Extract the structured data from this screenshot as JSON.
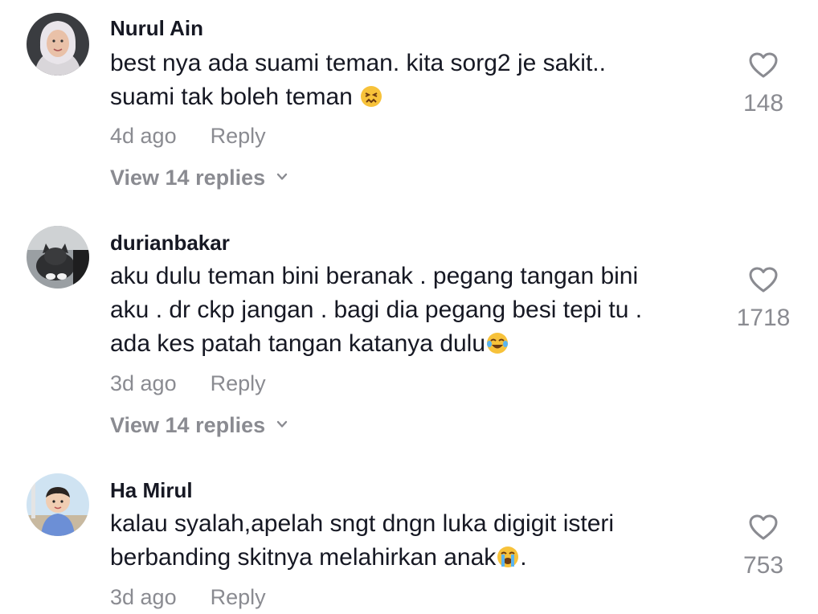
{
  "comments": [
    {
      "username": "Nurul Ain",
      "lines": [
        "best nya ada suami teman. kita sorg2 je sakit..",
        "suami tak boleh teman"
      ],
      "emoji": "confounded-face-emoji",
      "time": "4d ago",
      "reply_label": "Reply",
      "view_replies": "View 14 replies",
      "likes": "148"
    },
    {
      "username": "durianbakar",
      "lines": [
        "aku dulu teman bini beranak . pegang tangan bini",
        "aku . dr ckp jangan . bagi dia pegang besi tepi tu .",
        "ada kes patah tangan katanya dulu"
      ],
      "emoji": "tears-of-joy-emoji",
      "time": "3d ago",
      "reply_label": "Reply",
      "view_replies": "View 14 replies",
      "likes": "1718"
    },
    {
      "username": "Ha Mirul",
      "lines": [
        "kalau syalah,apelah sngt dngn luka digigit isteri",
        "berbanding skitnya melahirkan anak",
        "."
      ],
      "emoji": "loudly-crying-face-emoji",
      "time": "3d ago",
      "reply_label": "Reply",
      "likes": "753"
    }
  ],
  "colors": {
    "text": "#161823",
    "muted": "#8a8b91"
  }
}
